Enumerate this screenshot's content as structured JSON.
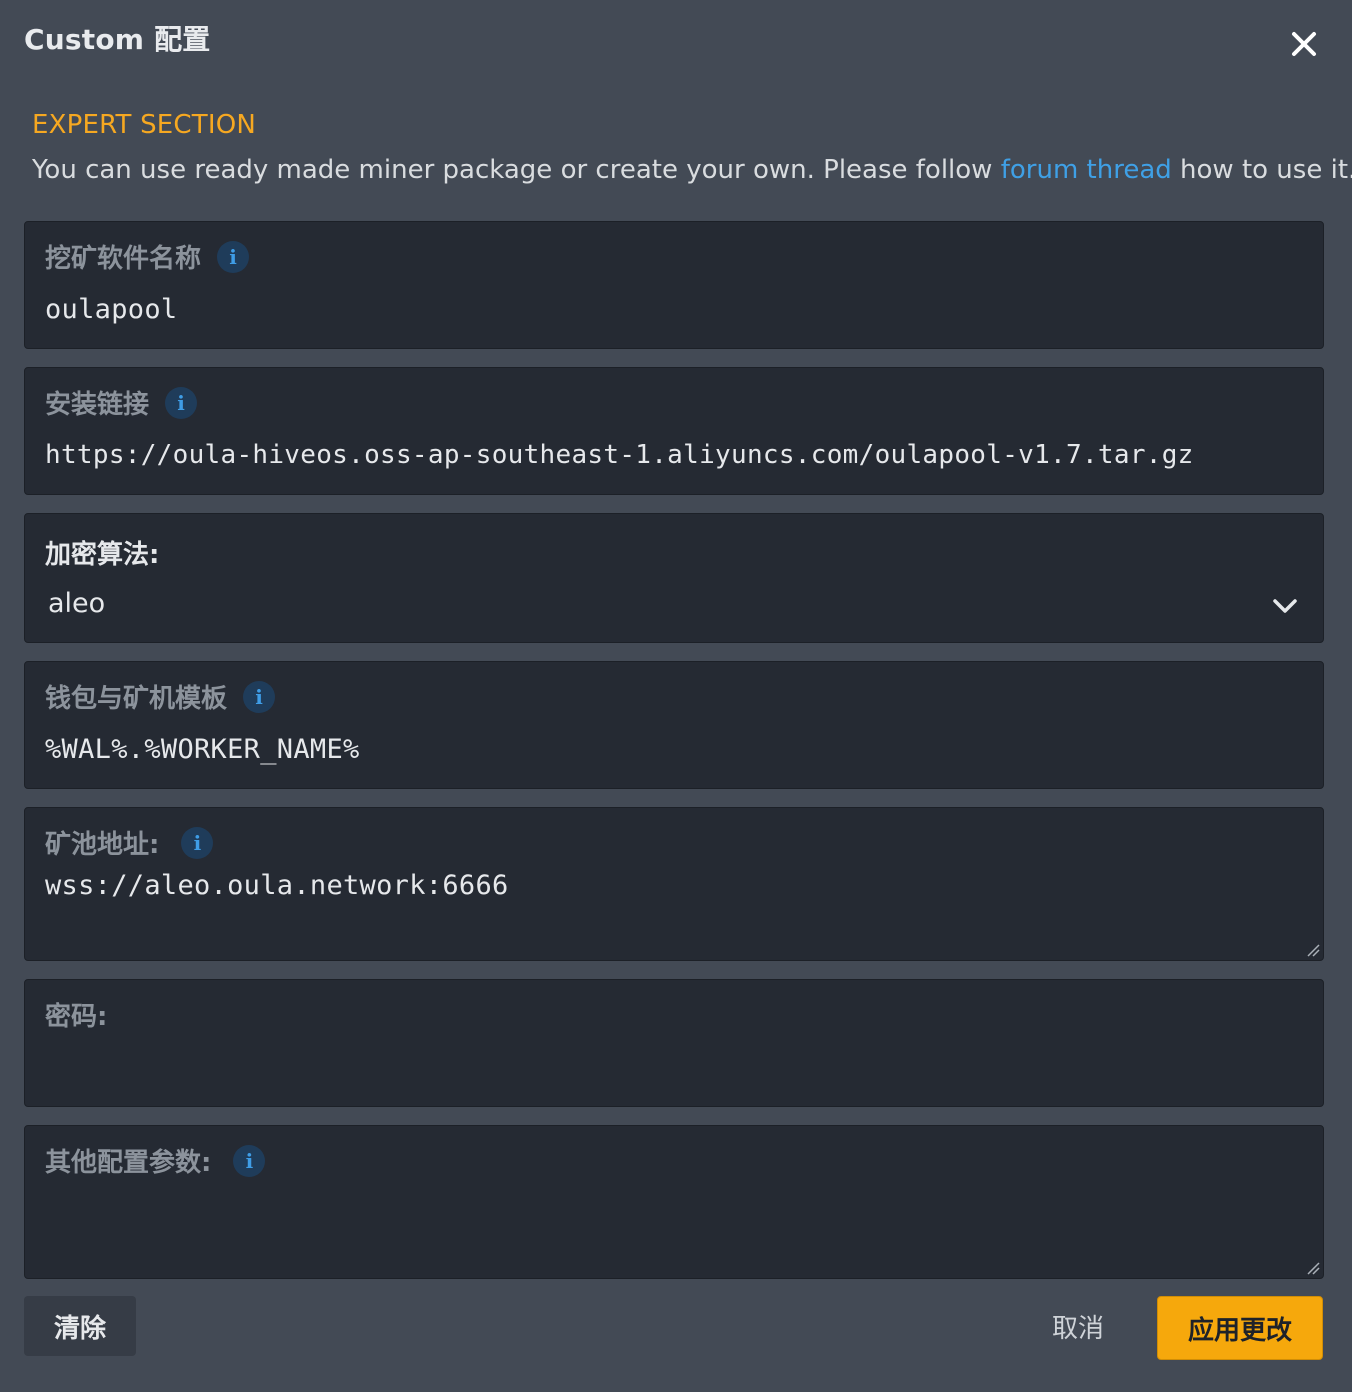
{
  "dialog": {
    "title": "Custom 配置",
    "close_icon": "close-icon"
  },
  "expert": {
    "title": "EXPERT SECTION",
    "desc_before": "You can use ready made miner package or create your own. Please follow ",
    "link_text": "forum thread",
    "desc_after": " how to use it."
  },
  "fields": {
    "miner_name": {
      "label": "挖矿软件名称",
      "value": "oulapool",
      "info_icon": "info-icon"
    },
    "install_url": {
      "label": "安装链接",
      "value": "https://oula-hiveos.oss-ap-southeast-1.aliyuncs.com/oulapool-v1.7.tar.gz",
      "info_icon": "info-icon"
    },
    "algorithm": {
      "label": "加密算法:",
      "value": "aleo",
      "dropdown_icon": "chevron-down-icon"
    },
    "wallet_template": {
      "label": "钱包与矿机模板",
      "value": "%WAL%.%WORKER_NAME%",
      "info_icon": "info-icon"
    },
    "pool_url": {
      "label": "矿池地址:",
      "value": "wss://aleo.oula.network:6666",
      "info_icon": "info-icon"
    },
    "password": {
      "label": "密码:",
      "value": ""
    },
    "extra_config": {
      "label": "其他配置参数:",
      "value": "",
      "info_icon": "info-icon"
    }
  },
  "footer": {
    "clear_label": "清除",
    "cancel_label": "取消",
    "apply_label": "应用更改"
  },
  "colors": {
    "background": "#434a55",
    "field_bg": "#252a33",
    "accent": "#f6a821",
    "link": "#3fa0e6",
    "apply_button": "#f6a80c"
  }
}
